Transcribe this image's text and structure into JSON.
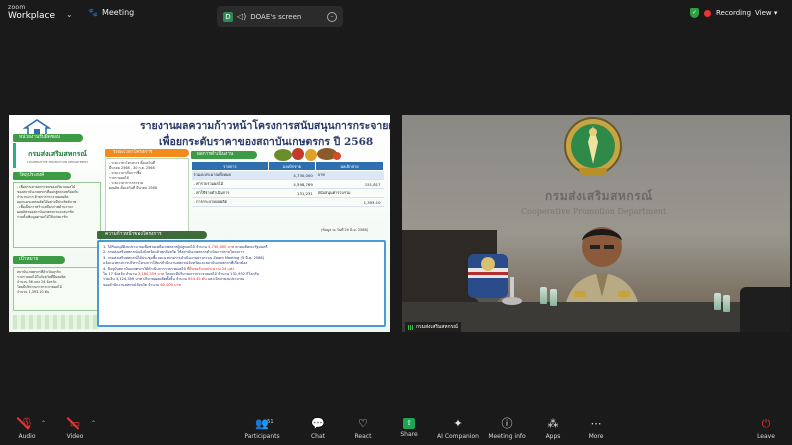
{
  "topbar": {
    "brand_top": "zoom",
    "brand_bottom": "Workplace",
    "meeting_label": "Meeting",
    "share_badge": "D",
    "share_label": "DOAE's screen",
    "recording_label": "Recording",
    "view_label": "View"
  },
  "slide": {
    "title_line1": "รายงานผลความก้าวหน้าโครงการสนับสนุนการกระจายผลไม้",
    "title_line2": "เพื่อยกระดับราคาของสถาบันเกษตรกร ปี 2568",
    "agency_header": "หน่วยงานรับผิดชอบ",
    "agency_name": "กรมส่งเสริมสหกรณ์",
    "agency_sub": "COOPERATIVE PROMOTION DEPARTMENT",
    "objective_header": "วัตถุประสงค์",
    "objective_text": [
      "- เพื่อบรรเทาผลกระทบของปริมาณผลไม้",
      "ของสถาบันเกษตรกรที่ออกสู่ตลาดพร้อมกัน",
      "จำนวนมาก ด้วยการกระจายผลผลิต",
      "ออกนอกแหล่งผลิตได้อย่างมีประสิทธิภาพ",
      "- เพื่อเป็นการสร้างเสถียรภาพด้านราคา",
      "ผลผลิตของสถาบันเกษตรกรและสมาชิก",
      "ร่วมทั้งเพิ่มมูลค่าผลไม้ให้แก่สมาชิก"
    ],
    "target_header": "เป้าหมาย",
    "target_text": [
      "สถาบันเกษตรกรที่ดำเนินธุรกิจ",
      "รวบรวมผลไม้ในจังหวัดที่มีผลผลิต",
      "จำนวน 56 แห่ง 24 จังหวัด",
      "โดยมีปริมาณการกระจายผลไม้",
      "จำนวน 1,393.10 ตัน"
    ],
    "project_header": "ระยะเวลาโครงการ",
    "project_text": [
      "- ระยะเวลาโครงการ ตั้งแต่วันที่",
      "มีนาคม 2568 - 30 ก.ค. 2568",
      "- ระยะเวลาเก็บการซื้อ",
      "รวบรวมผลไม้",
      "- ระยะเวลาการกระจาย",
      "ผลผลิต ตั้งแต่วันที่ มีนาคม 2568"
    ],
    "budget_header": "ผลการดำเนินงาน",
    "budget_cols": [
      "รายการ",
      "ผลเบิกจ่าย",
      "ผลเบิกจ่าย"
    ],
    "budget_sub": [
      "",
      "ผลเบิกจ่าย",
      "ผลเบิกจ่าย"
    ],
    "budget_rows": [
      [
        "รวมงบประมาณทั้งหมด",
        "4,730,000",
        "บาท"
      ],
      [
        "- ค่ารวบรวมผลไม้",
        "4,598,769",
        "151,817"
      ],
      [
        "- ค่าใช้จ่ายดำเนินการ",
        "131,231",
        "สนับสนุนค่ารวบรวม"
      ],
      [
        "- การกระจายผลผลิต",
        "",
        "1,393.10"
      ]
    ],
    "as_of": "(ข้อมูล ณ วันที่ 20 มิ.ย. 2568)",
    "progress_header": "ความก้าวหน้าของโครงการ",
    "progress_lines": [
      {
        "text": "1. ได้รับอนุมัติงบประมาณเพื่อช่วยเหลือเกษตรกรผู้ปลูกผลไม้ จำนวน ",
        "red": "4,730,000 บาท",
        "tail": " ตามมติคณะรัฐมนตรี"
      },
      {
        "text": "2. กรมส่งเสริมสหกรณ์แจ้งจังหวัดแล้วทุกจังหวัด ให้สถาบันเกษตรกรดำเนินการตามโครงการ",
        "red": "",
        "tail": ""
      },
      {
        "text": "3. กรมส่งเสริมสหกรณ์ได้ประชุมชี้แจงแนวทางการดำเนินงานผ่านระบบ Zoom Meeting (5 มี.ค. 2568)",
        "red": "",
        "tail": ""
      },
      {
        "text": "   แจ้งแนวทางการบริหารโครงการให้แก่สำนักงานสหกรณ์จังหวัดและสถาบันเกษตรกรที่เกี่ยวข้อง",
        "red": "",
        "tail": ""
      },
      {
        "text": "4. ปัจจุบันสถาบันเกษตรกรได้ดำเนินการรวบรวมผลไม้ ",
        "red": "ที่ยื่นขอรับงบประมาณ 24 แห่ง",
        "tail": ""
      },
      {
        "text": "   ใน 17 จังหวัด จำนวน ",
        "red": "3,184,359 บาท",
        "tail": " โดยจะมีปริมาณการกระจายผลไม้ จำนวน 131,952 กิโลกรัม"
      },
      {
        "text": "   รวมเงิน 3,124,359 บาท ปริมาณผลผลิตทั้งสิ้น จำนวน ",
        "red": "854.45 ตัน",
        "tail": " และเบิกจ่ายงบประมาณ"
      },
      {
        "text": "   ของสำนักงานสหกรณ์จังหวัด จำนวน ",
        "red": "60,000 บาท",
        "tail": ""
      }
    ]
  },
  "camera": {
    "dept_thai": "กรมส่งเสริมสหกรณ์",
    "dept_english": "Cooperative Promotion Department",
    "participant_name": "กรมส่งเสริมสหกรณ์"
  },
  "toolbar": {
    "audio_label": "Audio",
    "video_label": "Video",
    "participants_label": "Participants",
    "participants_count": "51",
    "chat_label": "Chat",
    "react_label": "React",
    "share_label": "Share",
    "companion_label": "AI Companion",
    "info_label": "Meeting info",
    "apps_label": "Apps",
    "more_label": "More",
    "leave_label": "Leave"
  },
  "colors": {
    "background": "#1a1a1a",
    "share_green": "#1ea453",
    "recording_red": "#e33333",
    "slide_green": "#3e9b45",
    "slide_orange": "#f28a1c",
    "table_blue": "#2f6fb0"
  }
}
